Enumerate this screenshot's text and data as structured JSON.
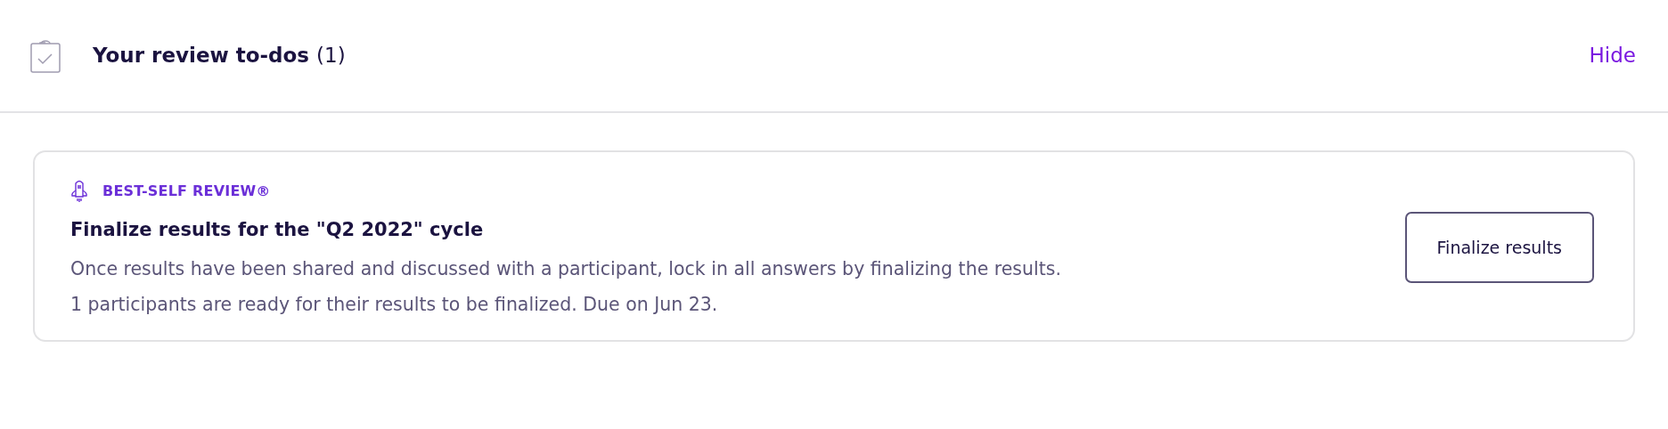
{
  "header": {
    "title": "Your review to-dos",
    "count": "(1)",
    "action": "Hide"
  },
  "todos": [
    {
      "category": "BEST-SELF REVIEW®",
      "title": "Finalize results for the \"Q2 2022\" cycle",
      "lines": [
        "Once results have been shared and discussed with a participant, lock in all answers by finalizing the results.",
        "1 participants are ready for their results to be finalized. Due on Jun 23."
      ],
      "button": "Finalize results"
    }
  ]
}
